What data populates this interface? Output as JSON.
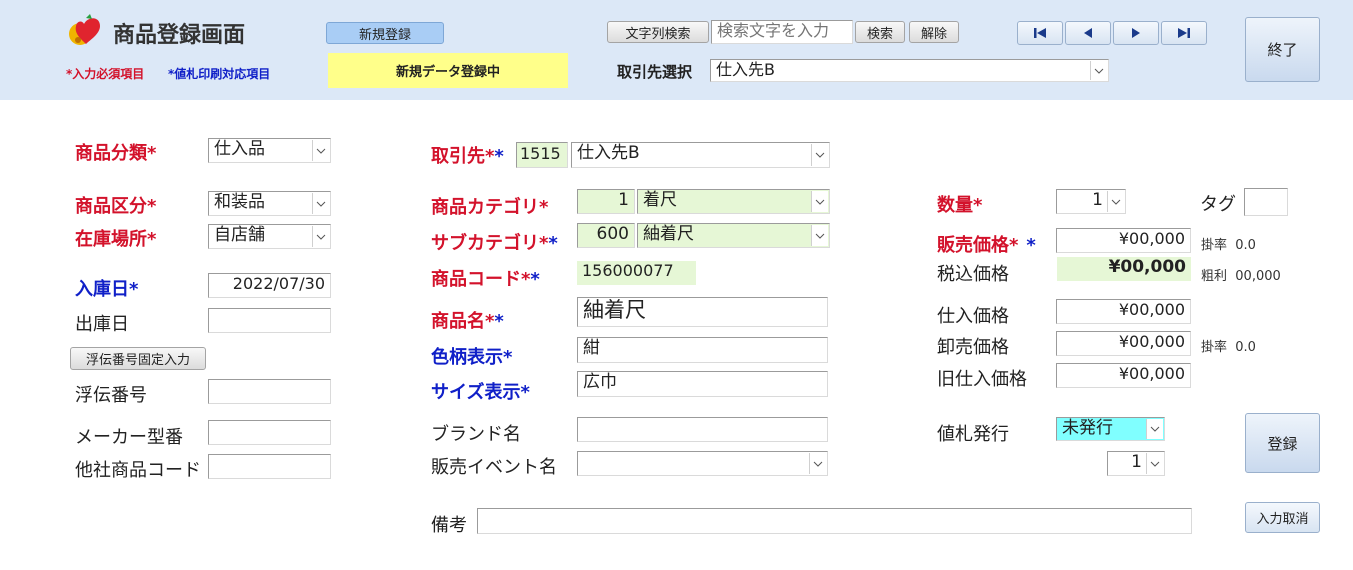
{
  "header": {
    "title": "商品登録画面",
    "legend_required": "*入力必須項目",
    "legend_price_tag": "*値札印刷対応項目",
    "new_button": "新規登録",
    "status": "新規データ登録中",
    "search_button": "文字列検索",
    "search_placeholder": "検索文字を入力",
    "search_exec": "検索",
    "search_clear": "解除",
    "supplier_select_label": "取引先選択",
    "supplier_select_value": "仕入先B",
    "exit_button": "終了"
  },
  "col1": {
    "category_label": "商品分類",
    "category_value": "仕入品",
    "kubun_label": "商品区分",
    "kubun_value": "和装品",
    "location_label": "在庫場所",
    "location_value": "自店舗",
    "arrival_label": "入庫日",
    "arrival_value": "2022/07/30",
    "shipping_label": "出庫日",
    "shipping_value": "",
    "voucher_fixed_button": "浮伝番号固定入力",
    "voucher_label": "浮伝番号",
    "voucher_value": "",
    "maker_label": "メーカー型番",
    "maker_value": "",
    "other_code_label": "他社商品コード",
    "other_code_value": ""
  },
  "col2": {
    "supplier_label": "取引先",
    "supplier_code": "1515",
    "supplier_name": "仕入先B",
    "category_label": "商品カテゴリ",
    "category_code": "1",
    "category_name": "着尺",
    "subcategory_label": "サブカテゴリ",
    "subcategory_code": "600",
    "subcategory_name": "紬着尺",
    "product_code_label": "商品コード",
    "product_code": "156000077",
    "product_name_label": "商品名",
    "product_name": "紬着尺",
    "color_label": "色柄表示",
    "color_value": "紺",
    "size_label": "サイズ表示",
    "size_value": "広巾",
    "brand_label": "ブランド名",
    "brand_value": "",
    "event_label": "販売イベント名",
    "event_value": "",
    "memo_label": "備考",
    "memo_value": ""
  },
  "col3": {
    "qty_label": "数量",
    "qty_value": "1",
    "tag_label": "タグ",
    "tag_value": "",
    "sale_price_label": "販売価格",
    "sale_price": "¥00,000",
    "rate_label": "掛率",
    "rate_value": "0.0",
    "tax_price_label": "税込価格",
    "tax_price": "¥00,000",
    "gross_label": "粗利",
    "gross_value": "00,000",
    "cost_label": "仕入価格",
    "cost_value": "¥00,000",
    "wholesale_label": "卸売価格",
    "wholesale_value": "¥00,000",
    "wholesale_rate_label": "掛率",
    "wholesale_rate_value": "0.0",
    "old_cost_label": "旧仕入価格",
    "old_cost_value": "¥00,000",
    "tag_issue_label": "値札発行",
    "tag_issue_value": "未発行",
    "tag_count_value": "1",
    "register_button": "登録",
    "cancel_button": "入力取消"
  },
  "colors": {
    "required": "#d3122b",
    "price_tag": "#1020c8",
    "header_bg": "#dce8f7",
    "status_bg": "#ffff8a"
  },
  "asterisk": "*"
}
